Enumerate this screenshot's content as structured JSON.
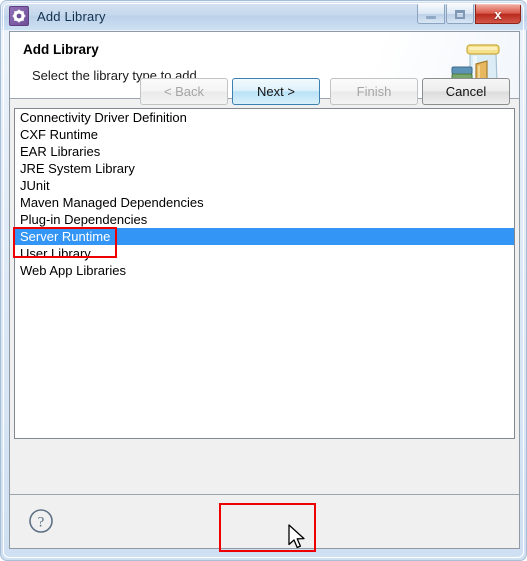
{
  "window": {
    "title": "Add Library",
    "app_icon": "gear-icon",
    "controls": {
      "minimize_label": "Minimize",
      "maximize_label": "Maximize",
      "close_label": "x"
    }
  },
  "header": {
    "title": "Add Library",
    "subtitle": "Select the library type to add.",
    "icon": "library-jar-books-icon"
  },
  "library_list": {
    "items": [
      {
        "label": "Connectivity Driver Definition",
        "selected": false
      },
      {
        "label": "CXF Runtime",
        "selected": false
      },
      {
        "label": "EAR Libraries",
        "selected": false
      },
      {
        "label": "JRE System Library",
        "selected": false
      },
      {
        "label": "JUnit",
        "selected": false
      },
      {
        "label": "Maven Managed Dependencies",
        "selected": false
      },
      {
        "label": "Plug-in Dependencies",
        "selected": false
      },
      {
        "label": "Server Runtime",
        "selected": true
      },
      {
        "label": "User Library",
        "selected": false
      },
      {
        "label": "Web App Libraries",
        "selected": false
      }
    ],
    "selection_color": "#3395f5"
  },
  "buttons": {
    "help_label": "?",
    "back": {
      "label": "< Back",
      "state": "disabled"
    },
    "next": {
      "label": "Next >",
      "state": "hover"
    },
    "finish": {
      "label": "Finish",
      "state": "disabled"
    },
    "cancel": {
      "label": "Cancel",
      "state": "enabled"
    }
  },
  "annotations": {
    "color": "#ee0000",
    "items": [
      {
        "target": "Server Runtime"
      },
      {
        "target": "Next >"
      }
    ]
  },
  "cursor": {
    "type": "arrow-pointer"
  }
}
